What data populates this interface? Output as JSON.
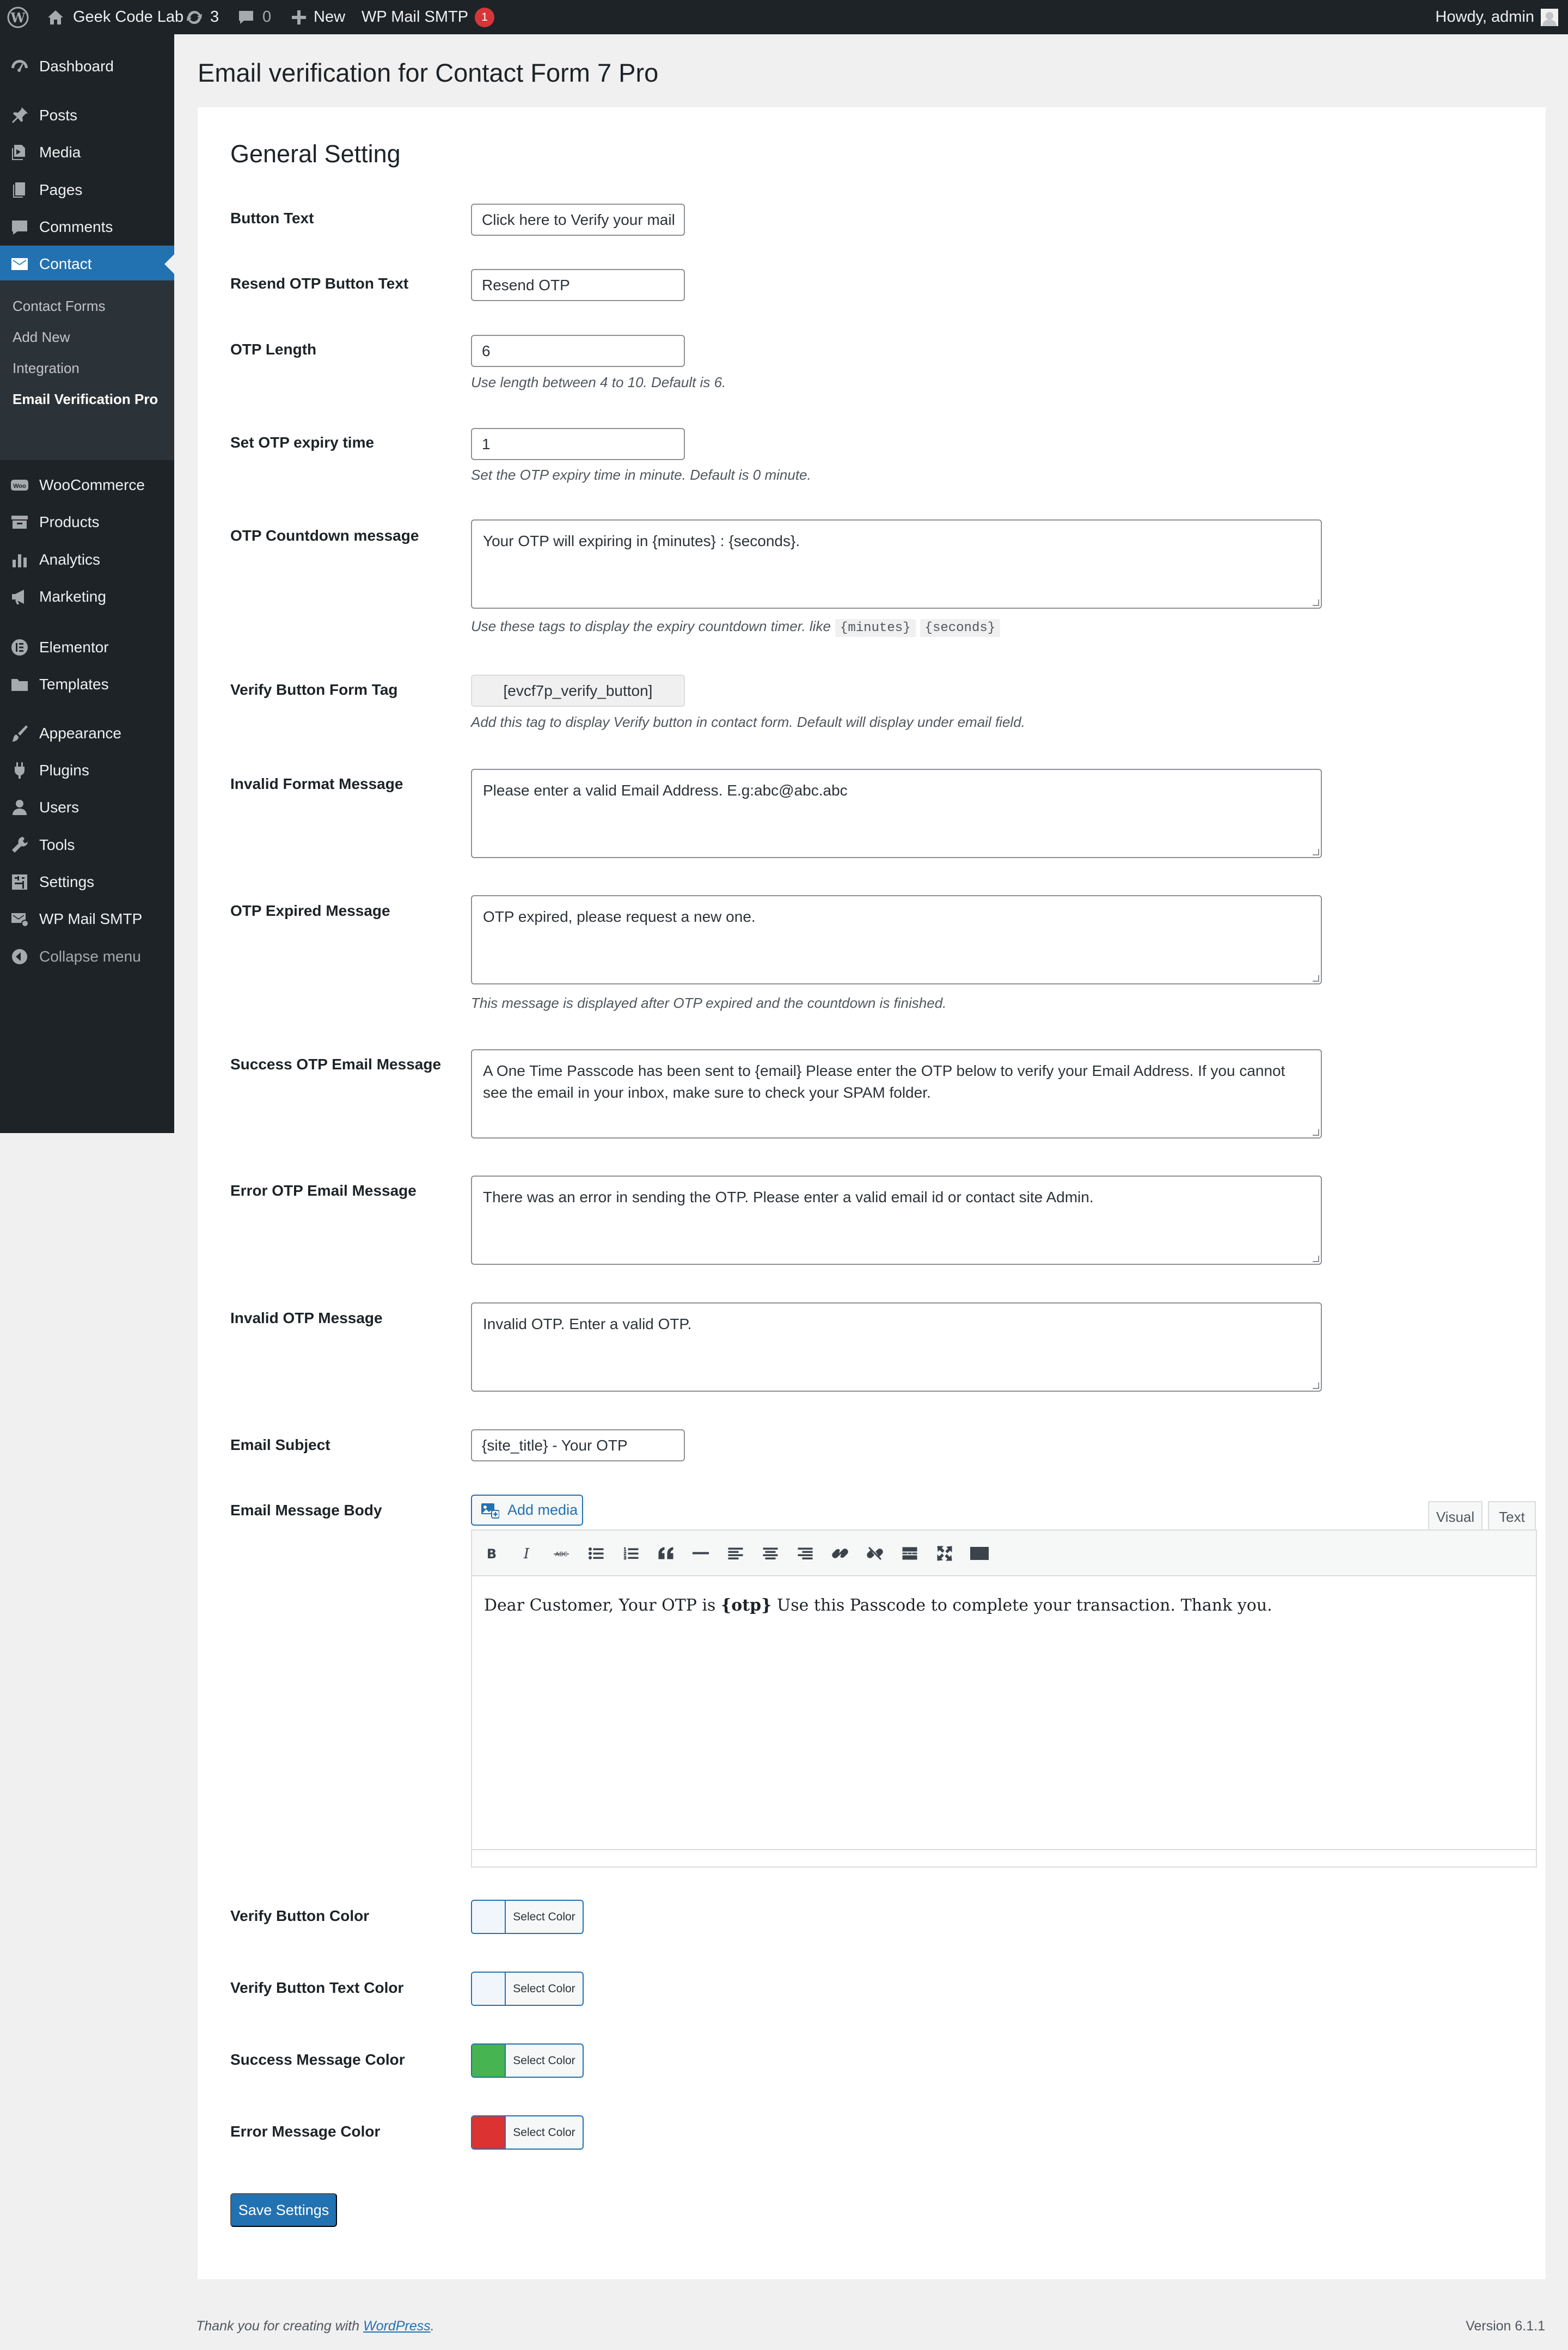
{
  "admin_bar": {
    "site_name": "Geek Code Lab",
    "updates_count": "3",
    "comments_count": "0",
    "new_label": "New",
    "smtp_label": "WP Mail SMTP",
    "smtp_badge": "1",
    "howdy": "Howdy, admin"
  },
  "sidebar": {
    "items": [
      {
        "label": "Dashboard",
        "icon": "dashboard-icon"
      },
      {
        "label": "Posts",
        "icon": "pin-icon"
      },
      {
        "label": "Media",
        "icon": "media-icon"
      },
      {
        "label": "Pages",
        "icon": "page-icon"
      },
      {
        "label": "Comments",
        "icon": "comment-icon"
      },
      {
        "label": "Contact",
        "icon": "mail-icon"
      },
      {
        "label": "WooCommerce",
        "icon": "woo-icon"
      },
      {
        "label": "Products",
        "icon": "archive-icon"
      },
      {
        "label": "Analytics",
        "icon": "chart-icon"
      },
      {
        "label": "Marketing",
        "icon": "megaphone-icon"
      },
      {
        "label": "Elementor",
        "icon": "elementor-icon"
      },
      {
        "label": "Templates",
        "icon": "folder-icon"
      },
      {
        "label": "Appearance",
        "icon": "brush-icon"
      },
      {
        "label": "Plugins",
        "icon": "plug-icon"
      },
      {
        "label": "Users",
        "icon": "user-icon"
      },
      {
        "label": "Tools",
        "icon": "wrench-icon"
      },
      {
        "label": "Settings",
        "icon": "settings-icon"
      },
      {
        "label": "WP Mail SMTP",
        "icon": "smtp-icon"
      }
    ],
    "submenu": [
      "Contact Forms",
      "Add New",
      "Integration",
      "Email Verification Pro"
    ],
    "collapse_label": "Collapse menu"
  },
  "page": {
    "title": "Email verification for Contact Form 7 Pro",
    "section_title": "General Setting"
  },
  "fields": {
    "button_text": {
      "label": "Button Text",
      "value": "Click here to Verify your mail"
    },
    "resend": {
      "label": "Resend OTP Button Text",
      "value": "Resend OTP"
    },
    "otp_length": {
      "label": "OTP Length",
      "value": "6",
      "desc": "Use length between 4 to 10. Default is 6."
    },
    "expiry": {
      "label": "Set OTP expiry time",
      "value": "1",
      "desc": "Set the OTP expiry time in minute. Default is 0 minute."
    },
    "countdown": {
      "label": "OTP Countdown message",
      "value": "Your OTP will expiring in {minutes} : {seconds}.",
      "desc": "Use these tags to display the expiry countdown timer. like",
      "tag1": "{minutes}",
      "tag2": "{seconds}"
    },
    "form_tag": {
      "label": "Verify Button Form Tag",
      "value": "[evcf7p_verify_button]",
      "desc": "Add this tag to display Verify button in contact form. Default will display under email field."
    },
    "invalid_format": {
      "label": "Invalid Format Message",
      "value": "Please enter a valid Email Address. E.g:abc@abc.abc"
    },
    "expired": {
      "label": "OTP Expired Message",
      "value": "OTP expired, please request a new one.",
      "desc": "This message is displayed after OTP expired and the countdown is finished."
    },
    "success": {
      "label": "Success OTP Email Message",
      "value": "A One Time Passcode has been sent to {email} Please enter the OTP below to verify your Email Address. If you cannot see the email in your inbox, make sure to check your SPAM folder."
    },
    "error": {
      "label": "Error OTP Email Message",
      "value": "There was an error in sending the OTP. Please enter a valid email id or contact site Admin."
    },
    "invalid_otp": {
      "label": "Invalid OTP Message",
      "value": "Invalid OTP. Enter a valid OTP."
    },
    "subject": {
      "label": "Email Subject",
      "value": "{site_title} - Your OTP"
    },
    "body": {
      "label": "Email Message Body",
      "add_media": "Add media",
      "tab_visual": "Visual",
      "tab_text": "Text",
      "content_before": "Dear Customer, Your OTP is ",
      "content_bold": "{otp}",
      "content_after": " Use this Passcode to complete your transaction. Thank you."
    }
  },
  "colors": {
    "verify_button": {
      "label": "Verify Button Color",
      "swatch": "#f0f6fc",
      "button": "Select Color"
    },
    "verify_text": {
      "label": "Verify Button Text Color",
      "swatch": "#f0f6fc",
      "button": "Select Color"
    },
    "success_msg": {
      "label": "Success Message Color",
      "swatch": "#46b450",
      "button": "Select Color"
    },
    "error_msg": {
      "label": "Error Message Color",
      "swatch": "#dc3232",
      "button": "Select Color"
    }
  },
  "save_label": "Save Settings",
  "footer": {
    "thanks_prefix": "Thank you for creating with ",
    "thanks_link": "WordPress",
    "thanks_suffix": ".",
    "version": "Version 6.1.1"
  }
}
